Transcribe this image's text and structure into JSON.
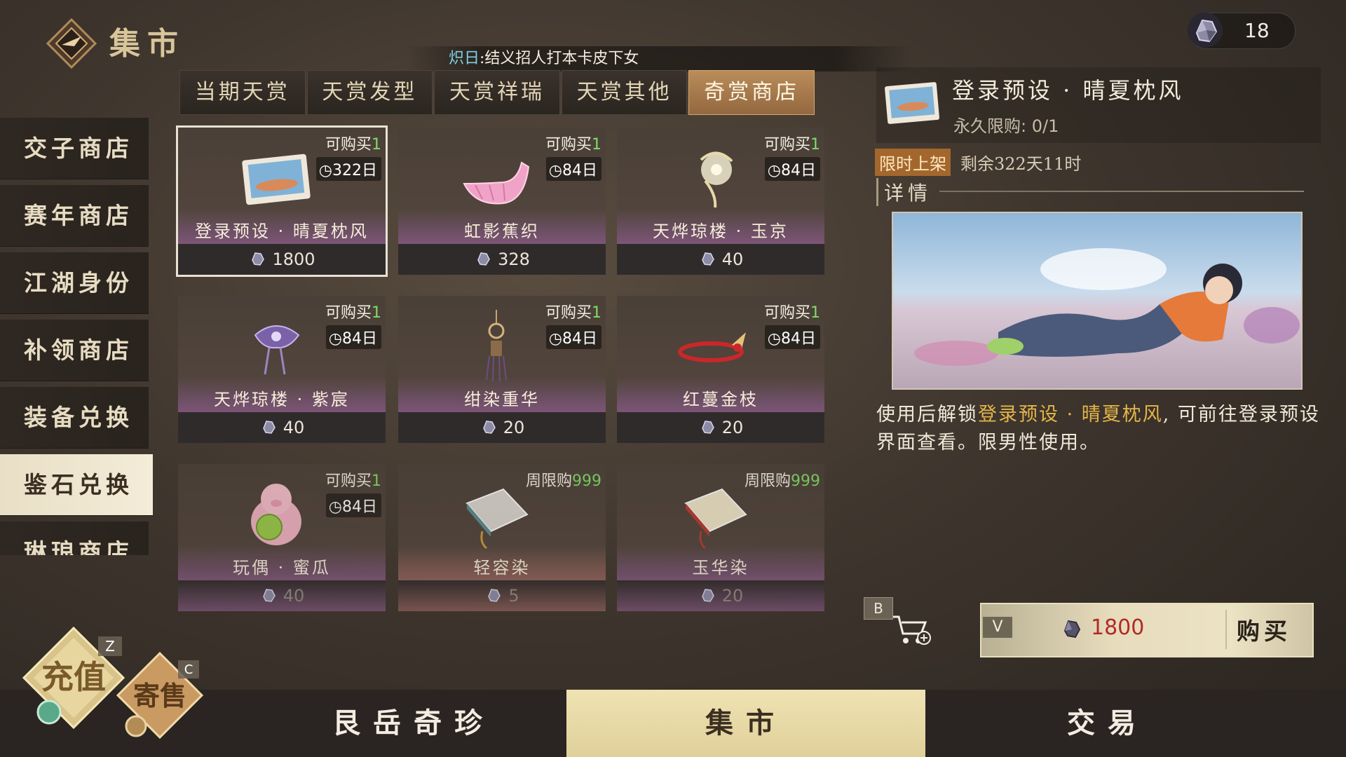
{
  "header": {
    "title": "集市",
    "ticker": {
      "name": "炽日",
      "message": ":结义招人打本卡皮下女"
    },
    "currency": {
      "icon": "gem-icon",
      "amount": "18"
    }
  },
  "tabs": [
    {
      "label": "当期天赏",
      "active": false
    },
    {
      "label": "天赏发型",
      "active": false
    },
    {
      "label": "天赏祥瑞",
      "active": false
    },
    {
      "label": "天赏其他",
      "active": false
    },
    {
      "label": "奇赏商店",
      "active": true
    }
  ],
  "sidebar": [
    {
      "label": "交子商店",
      "active": false
    },
    {
      "label": "赛年商店",
      "active": false
    },
    {
      "label": "江湖身份",
      "active": false
    },
    {
      "label": "补领商店",
      "active": false
    },
    {
      "label": "装备兑换",
      "active": false
    },
    {
      "label": "鉴石兑换",
      "active": true
    },
    {
      "label": "琳琅商店",
      "active": false
    }
  ],
  "items": [
    {
      "name": "登录预设 · 晴夏枕风",
      "limit_prefix": "可购买",
      "limit_num": "1",
      "days": "322日",
      "price": "1800",
      "icon": "photo-icon"
    },
    {
      "name": "虹影蕉织",
      "limit_prefix": "可购买",
      "limit_num": "1",
      "days": "84日",
      "price": "328",
      "icon": "pink-boat-icon"
    },
    {
      "name": "天烨琼楼 · 玉京",
      "limit_prefix": "可购买",
      "limit_num": "1",
      "days": "84日",
      "price": "40",
      "icon": "jade-ornament-icon"
    },
    {
      "name": "天烨琼楼 · 紫宸",
      "limit_prefix": "可购买",
      "limit_num": "1",
      "days": "84日",
      "price": "40",
      "icon": "purple-ornament-icon"
    },
    {
      "name": "绀染重华",
      "limit_prefix": "可购买",
      "limit_num": "1",
      "days": "84日",
      "price": "20",
      "icon": "pendant-icon"
    },
    {
      "name": "红蔓金枝",
      "limit_prefix": "可购买",
      "limit_num": "1",
      "days": "84日",
      "price": "20",
      "icon": "red-bracelet-icon"
    },
    {
      "name": "玩偶 · 蜜瓜",
      "limit_prefix": "可购买",
      "limit_num": "1",
      "days": "84日",
      "price": "40",
      "icon": "pig-doll-icon"
    },
    {
      "name": "轻容染",
      "limit_prefix": "周限购",
      "limit_num": "999",
      "days": "",
      "price": "5",
      "icon": "dye-book-icon"
    },
    {
      "name": "玉华染",
      "limit_prefix": "周限购",
      "limit_num": "999",
      "days": "",
      "price": "20",
      "icon": "dye-book-icon"
    }
  ],
  "detail": {
    "name": "登录预设 · 晴夏枕风",
    "limit": "永久限购: 0/1",
    "limited_tag": "限时上架",
    "remaining": "剩余322天11时",
    "section_label": "详情",
    "desc_before": "使用后解锁",
    "desc_highlight": "登录预设 · 晴夏枕风",
    "desc_after": ", 可前往登录预设界面查看。限男性使用。"
  },
  "cart": {
    "key": "B",
    "icon": "cart-add-icon"
  },
  "buy": {
    "key": "V",
    "price": "1800",
    "label": "购买"
  },
  "bottom_nav": [
    {
      "label": "艮岳奇珍",
      "active": false
    },
    {
      "label": "集市",
      "active": true
    },
    {
      "label": "交易",
      "active": false
    }
  ],
  "corner_buttons": {
    "recharge": {
      "label": "充值",
      "key": "Z"
    },
    "consign": {
      "label": "寄售",
      "key": "C"
    }
  },
  "colors": {
    "accent_gold": "#e4b64a",
    "tab_active": "#b98c5a",
    "limit_green": "#7fdc67",
    "price_red": "#b02b25",
    "ticker_name": "#7fd0e8"
  }
}
